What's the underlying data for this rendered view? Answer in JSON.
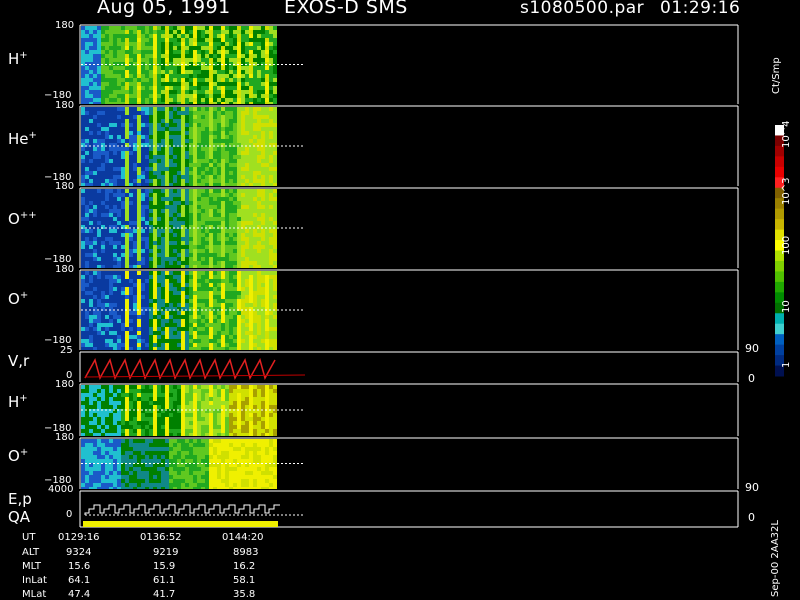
{
  "header": {
    "date": "Aug 05, 1991",
    "instrument": "EXOS-D SMS",
    "file": "s1080500.par",
    "time": "01:29:16"
  },
  "colorbar": {
    "title": "Ct/Smp",
    "tick_labels": [
      "10^4",
      "10^3",
      "100",
      "10",
      "1"
    ],
    "colors": [
      "#ffffff",
      "#7a0000",
      "#a00000",
      "#c80000",
      "#e80000",
      "#ff2020",
      "#806000",
      "#9a8000",
      "#b09a00",
      "#c8b400",
      "#e0e000",
      "#ffff00",
      "#b0e000",
      "#80d000",
      "#50c000",
      "#20a800",
      "#008c00",
      "#007000",
      "#00b0b0",
      "#40d0d0",
      "#0060c0",
      "#0040a0",
      "#002a80",
      "#001050"
    ]
  },
  "panels": [
    {
      "name": "H+",
      "label": "H",
      "sup": "+",
      "ymax": "180",
      "ymin": "−180"
    },
    {
      "name": "He+",
      "label": "He",
      "sup": "+",
      "ymax": "180",
      "ymin": "−180"
    },
    {
      "name": "O++",
      "label": "O",
      "sup": "++",
      "ymax": "180",
      "ymin": "−180"
    },
    {
      "name": "O+",
      "label": "O",
      "sup": "+",
      "ymax": "180",
      "ymin": "−180"
    },
    {
      "name": "Vr",
      "label": "V,r",
      "sup": "",
      "ymax": "25",
      "ymin": "0",
      "right_top": "90",
      "right_bottom": "0"
    },
    {
      "name": "H+ (2)",
      "label": "H",
      "sup": "+",
      "ymax": "180",
      "ymin": "−180"
    },
    {
      "name": "O+ (2)",
      "label": "O",
      "sup": "+",
      "ymax": "180",
      "ymin": "−180"
    },
    {
      "name": "Ep QA",
      "label": "E,p",
      "label2": "QA",
      "ymax": "4000",
      "ymin": "0",
      "right_top": "90",
      "right_bottom": "0"
    }
  ],
  "footer": {
    "rows": [
      {
        "label": "UT",
        "values": [
          "0129:16",
          "0136:52",
          "0144:20"
        ]
      },
      {
        "label": "ALT",
        "values": [
          "9324",
          "9219",
          "8983"
        ]
      },
      {
        "label": "MLT",
        "values": [
          "15.6",
          "15.9",
          "16.2"
        ]
      },
      {
        "label": "InLat",
        "values": [
          "64.1",
          "61.1",
          "58.1"
        ]
      },
      {
        "label": "MLat",
        "values": [
          "47.4",
          "41.7",
          "35.8"
        ]
      }
    ],
    "side_note": "Sep-00 2AA32L"
  },
  "chart_data": {
    "type": "heatmap",
    "title": "Aug 05, 1991   EXOS-D SMS",
    "x_tick_labels": [
      "0129:16",
      "0136:52",
      "0144:20"
    ],
    "panels": [
      "H+",
      "He+",
      "O++",
      "O+",
      "V,r",
      "H+",
      "O+",
      "E,p QA"
    ],
    "pitch_angle_range": [
      -180,
      180
    ],
    "Vr_range": [
      0,
      25
    ],
    "Ep_range": [
      0,
      4000
    ],
    "colorbar_units": "Ct/Smp",
    "colorbar_range": [
      1,
      10000
    ],
    "colorbar_scale": "log"
  }
}
